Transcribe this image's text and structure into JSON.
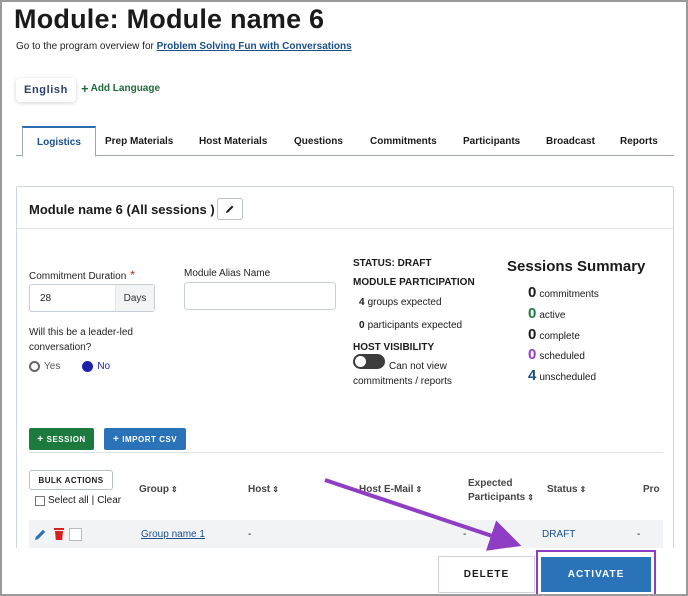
{
  "header": {
    "title": "Module: Module name 6",
    "overview_prefix": "Go to the program overview for",
    "program_link": "Problem Solving Fun with Conversations"
  },
  "languages": {
    "current": "English",
    "add_label": "Add Language"
  },
  "tabs": [
    {
      "label": "Logistics",
      "active": true
    },
    {
      "label": "Prep Materials"
    },
    {
      "label": "Host Materials"
    },
    {
      "label": "Questions"
    },
    {
      "label": "Commitments"
    },
    {
      "label": "Participants"
    },
    {
      "label": "Broadcast"
    },
    {
      "label": "Reports"
    }
  ],
  "card": {
    "title": "Module name 6 (All sessions )",
    "commitment_duration": {
      "label": "Commitment Duration",
      "required_mark": "*",
      "value": "28",
      "unit": "Days"
    },
    "alias": {
      "label": "Module Alias Name",
      "value": ""
    },
    "leader_led": {
      "question": "Will this be a leader-led conversation?",
      "options": [
        "Yes",
        "No"
      ],
      "selected": "No"
    },
    "status": "STATUS: DRAFT",
    "participation": {
      "title": "MODULE PARTICIPATION",
      "groups_count": "4",
      "groups_label": "groups expected",
      "participants_count": "0",
      "participants_label": "participants expected"
    },
    "host_visibility": {
      "title": "HOST VISIBILITY",
      "toggle_on": false,
      "text": "Can not view commitments / reports"
    },
    "sessions_summary": {
      "title": "Sessions Summary",
      "items": [
        {
          "count": "0",
          "label": "commitments",
          "color": "#1a1a1a"
        },
        {
          "count": "0",
          "label": "active",
          "color": "#1d7a3e"
        },
        {
          "count": "0",
          "label": "complete",
          "color": "#1a1a1a"
        },
        {
          "count": "0",
          "label": "scheduled",
          "color": "#8e3dc4"
        },
        {
          "count": "4",
          "label": "unscheduled",
          "color": "#1f4e79"
        }
      ]
    },
    "buttons": {
      "session": "SESSION",
      "import": "IMPORT CSV",
      "bulk": "BULK ACTIONS",
      "select_all": "Select all",
      "clear": "Clear"
    },
    "table": {
      "headers": [
        "Group",
        "Host",
        "Host E-Mail",
        "Expected Participants",
        "Status",
        "Pro"
      ],
      "rows": [
        {
          "group": "Group name 1",
          "host": "-",
          "email": "",
          "expected": "-",
          "status": "DRAFT",
          "pro": "-"
        }
      ]
    }
  },
  "footer": {
    "delete": "DELETE",
    "activate": "ACTIVATE"
  },
  "colors": {
    "accent_blue": "#2a73b8",
    "green": "#1d7a3e",
    "highlight_purple": "#8e3dc4",
    "required_red": "#c41818"
  }
}
